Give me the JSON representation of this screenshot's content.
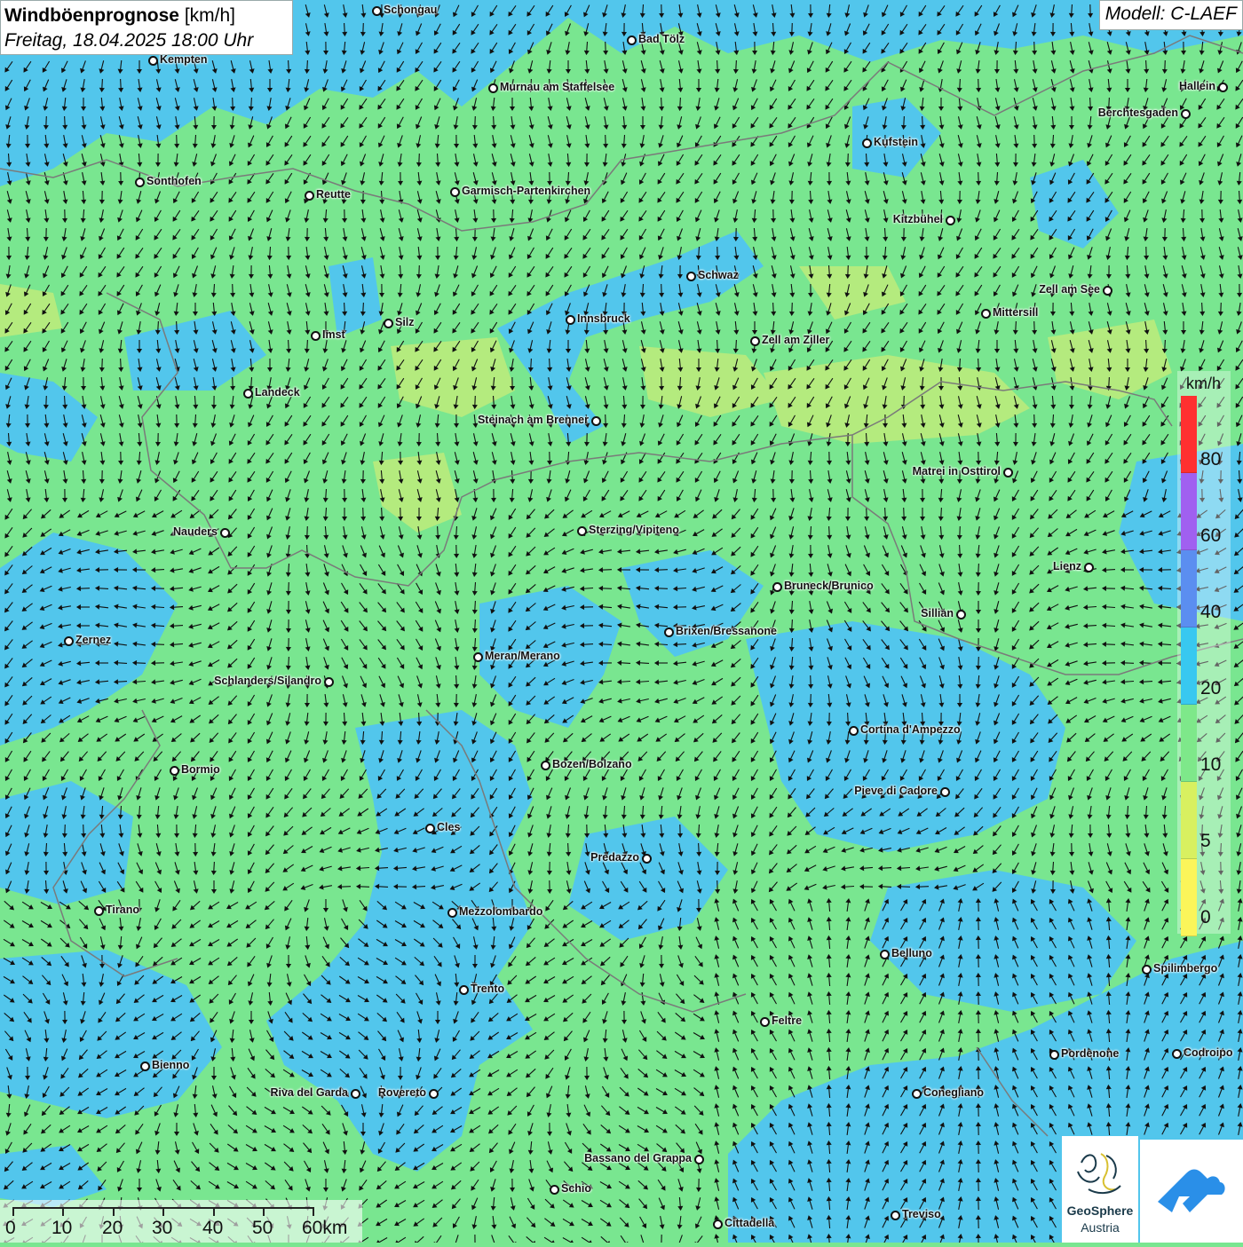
{
  "header": {
    "title": "Windböenprognose",
    "unit": "[km/h]",
    "datetime": "Freitag, 18.04.2025 18:00 Uhr",
    "model": "Modell: C-LAEF"
  },
  "legend": {
    "unit": "km/h",
    "ticks": [
      "80",
      "60",
      "40",
      "20",
      "10",
      "5",
      "0"
    ],
    "colors": [
      "#ff3030",
      "#a060f0",
      "#5b8ef0",
      "#38c8f0",
      "#7ee88a",
      "#d8f060",
      "#fbf55a"
    ]
  },
  "scale": {
    "labels": [
      "0",
      "10",
      "20",
      "30",
      "40",
      "50",
      "60km"
    ]
  },
  "logo": {
    "line1": "GeoSphere",
    "line2": "Austria"
  },
  "colors": {
    "calm_blue": "#52c6ec",
    "green": "#79e690",
    "yellow_green": "#c8ec78",
    "border_gray": "#7a7a7a",
    "arrow": "#111111"
  },
  "places": [
    "Schongau",
    "Bad Tölz",
    "Kempten",
    "Murnau am Staffelsee",
    "Hallein",
    "Berchtesgaden",
    "Kufstein",
    "Sonthofen",
    "Reutte",
    "Garmisch-Partenkirchen",
    "Kitzbühel",
    "Schwaz",
    "Zell am See",
    "Innsbruck",
    "Mittersill",
    "Silz",
    "Imst",
    "Zell am Ziller",
    "Landeck",
    "Steinach am Brenner",
    "Matrei in Osttirol",
    "Nauders",
    "Sterzing/Vipiteno",
    "Lienz",
    "Bruneck/Brunico",
    "Sillian",
    "Brixen/Bressanone",
    "Zernez",
    "Meran/Merano",
    "Schlanders/Silandro",
    "Cortina d'Ampezzo",
    "Bozen/Bolzano",
    "Bormio",
    "Pieve di Cadore",
    "Cles",
    "Predazzo",
    "Tirano",
    "Mezzolombardo",
    "Belluno",
    "Spilimbergo",
    "Trento",
    "Feltre",
    "Pordenone",
    "Codroipo",
    "Bienno",
    "Riva del Garda",
    "Rovereto",
    "Conegliano",
    "Bassano del Grappa",
    "Schio",
    "Treviso",
    "Cittadella"
  ]
}
